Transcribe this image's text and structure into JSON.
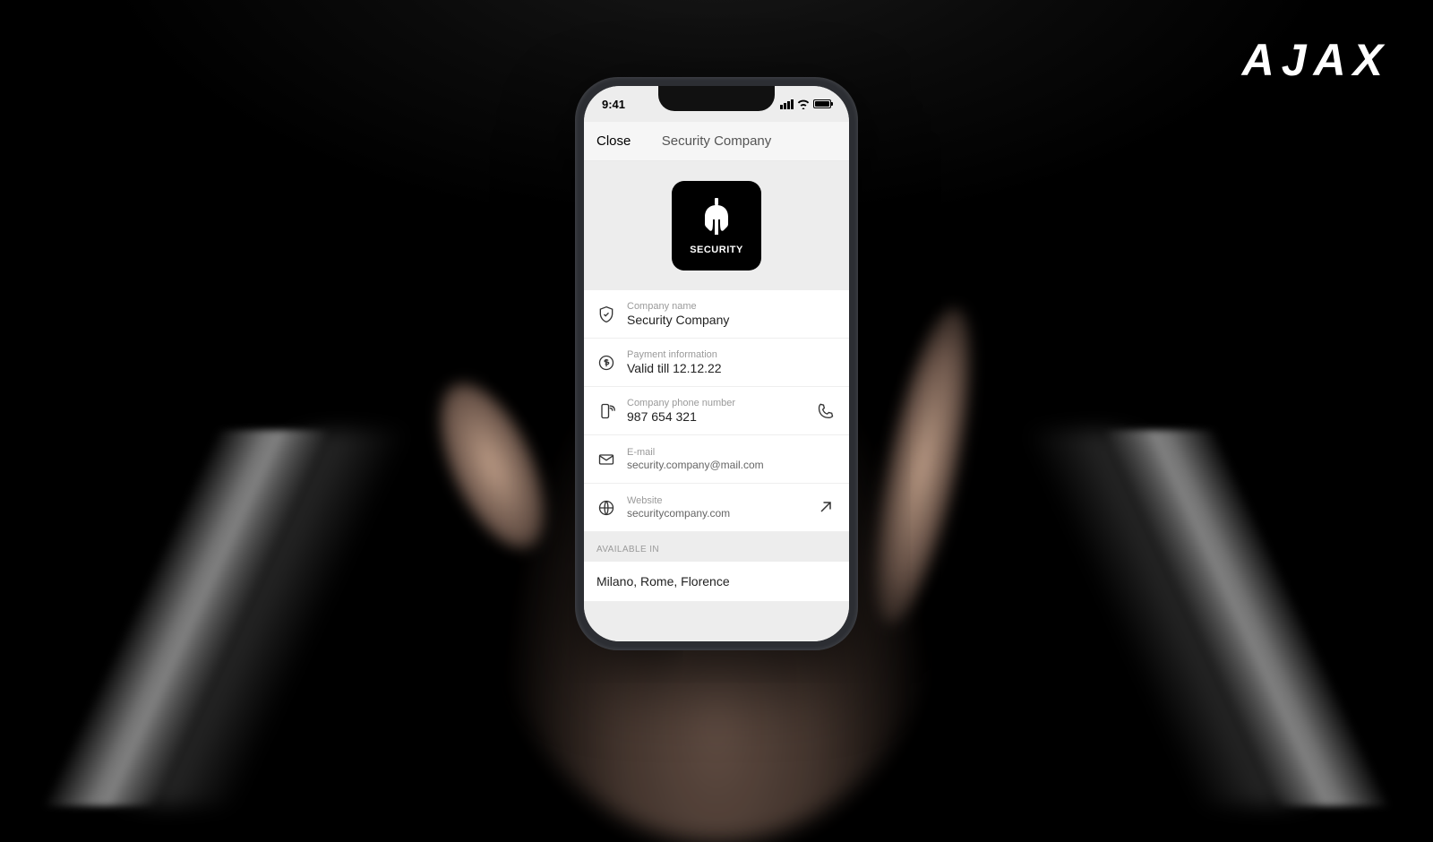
{
  "brand": "AJAX",
  "statusbar": {
    "time": "9:41"
  },
  "nav": {
    "close": "Close",
    "title": "Security Company"
  },
  "logo": {
    "text": "SECURITY"
  },
  "rows": {
    "name": {
      "label": "Company name",
      "value": "Security Company"
    },
    "payment": {
      "label": "Payment information",
      "value": "Valid till 12.12.22"
    },
    "phone": {
      "label": "Company phone number",
      "value": "987 654 321"
    },
    "email": {
      "label": "E-mail",
      "value": "security.company@mail.com"
    },
    "website": {
      "label": "Website",
      "value": "securitycompany.com"
    }
  },
  "available": {
    "header": "AVAILABLE IN",
    "value": "Milano, Rome, Florence"
  }
}
